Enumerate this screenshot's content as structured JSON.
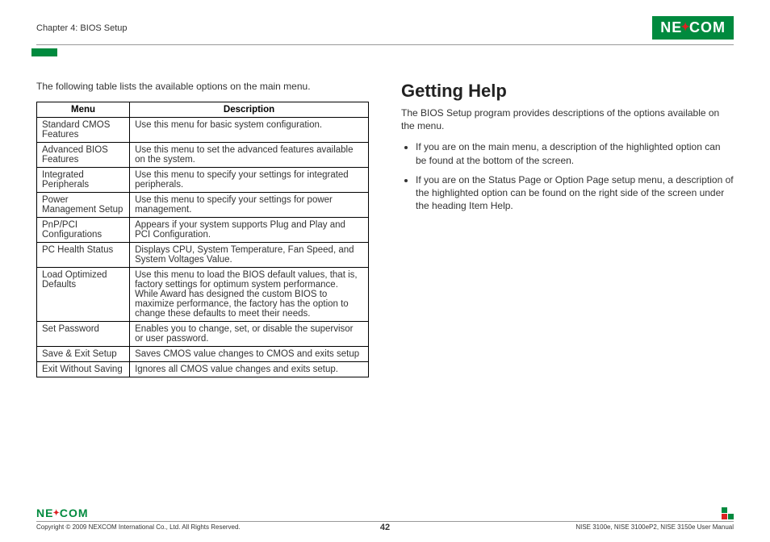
{
  "header": {
    "chapter": "Chapter 4: BIOS Setup",
    "logo_text_1": "NE",
    "logo_text_2": "COM"
  },
  "left": {
    "intro": "The following table lists the available options on the main menu.",
    "table": {
      "col_menu": "Menu",
      "col_desc": "Description",
      "rows": [
        {
          "menu": "Standard CMOS Features",
          "desc": "Use this menu for basic system configuration."
        },
        {
          "menu": "Advanced BIOS Features",
          "desc": "Use this menu to set the advanced features available on the system."
        },
        {
          "menu": "Integrated Peripherals",
          "desc": "Use this menu to specify your settings for integrated peripherals."
        },
        {
          "menu": "Power Management Setup",
          "desc": "Use this menu to specify your settings for power management."
        },
        {
          "menu": "PnP/PCI Configurations",
          "desc": "Appears if your system supports Plug and Play and PCI Configuration."
        },
        {
          "menu": "PC Health Status",
          "desc": "Displays CPU, System Temperature, Fan Speed, and System Voltages Value."
        },
        {
          "menu": "Load Optimized Defaults",
          "desc": "Use this menu to load the BIOS default values, that is, factory settings for optimum system performance. While Award has designed the custom BIOS to maximize performance, the factory has the option to change these defaults to meet their needs."
        },
        {
          "menu": "Set Password",
          "desc": "Enables you to change, set, or disable the supervisor or user password."
        },
        {
          "menu": "Save & Exit Setup",
          "desc": "Saves CMOS value changes to CMOS and exits setup"
        },
        {
          "menu": "Exit Without Saving",
          "desc": "Ignores all CMOS value changes and exits setup."
        }
      ]
    }
  },
  "right": {
    "heading": "Getting Help",
    "para": "The BIOS Setup program provides descriptions of the options available on the menu.",
    "bullets": [
      "If you are on the main menu, a description of the highlighted option can be found at the bottom of the screen.",
      "If you are on the Status Page or Option Page setup menu, a description of the highlighted option can be found on the right side of the screen under the heading Item Help."
    ]
  },
  "footer": {
    "copyright": "Copyright © 2009 NEXCOM International Co., Ltd. All Rights Reserved.",
    "page": "42",
    "manual": "NISE 3100e, NISE 3100eP2, NISE 3150e User Manual"
  }
}
